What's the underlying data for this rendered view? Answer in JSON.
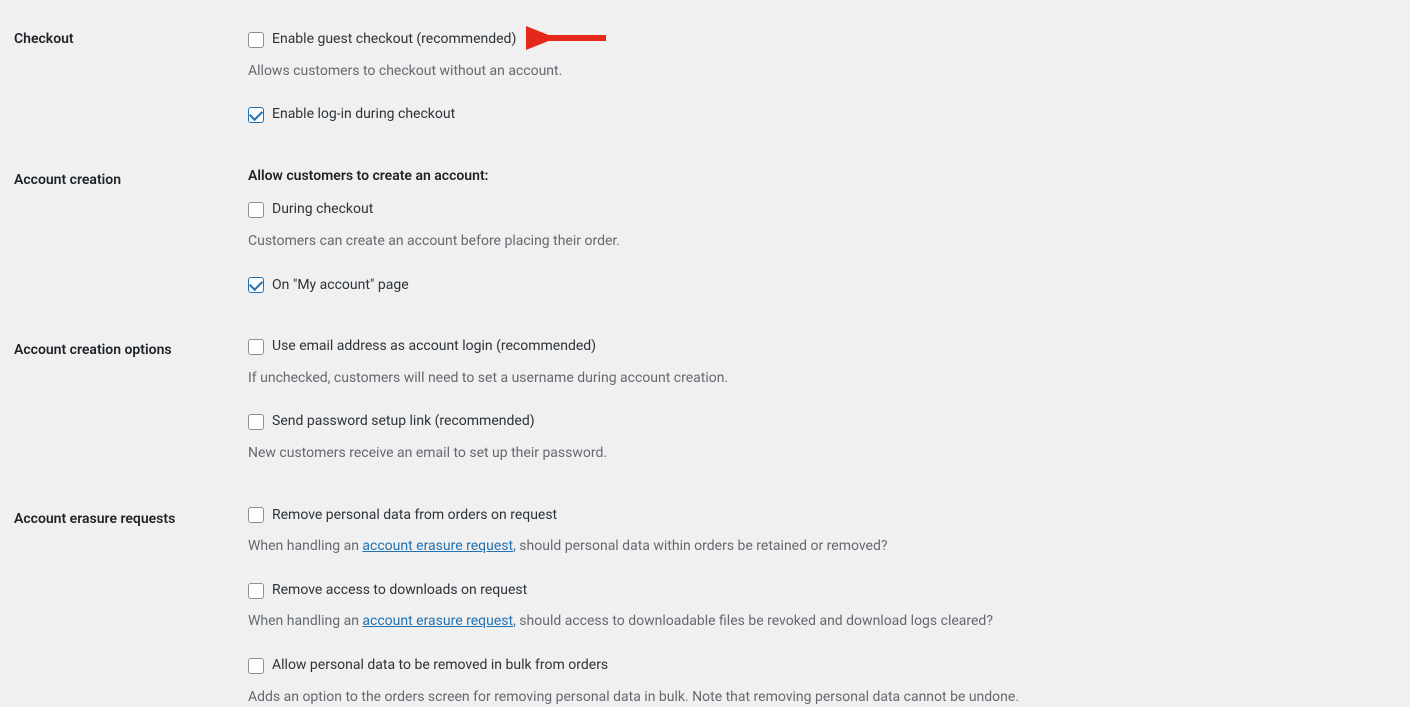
{
  "sections": {
    "checkout": {
      "title": "Checkout",
      "guest_checkout_label": "Enable guest checkout (recommended)",
      "guest_checkout_desc": "Allows customers to checkout without an account.",
      "login_during_checkout_label": "Enable log-in during checkout"
    },
    "account_creation": {
      "title": "Account creation",
      "subheading": "Allow customers to create an account:",
      "during_checkout_label": "During checkout",
      "during_checkout_desc": "Customers can create an account before placing their order.",
      "my_account_label": "On \"My account\" page"
    },
    "account_creation_options": {
      "title": "Account creation options",
      "email_login_label": "Use email address as account login (recommended)",
      "email_login_desc": "If unchecked, customers will need to set a username during account creation.",
      "password_link_label": "Send password setup link (recommended)",
      "password_link_desc": "New customers receive an email to set up their password."
    },
    "account_erasure": {
      "title": "Account erasure requests",
      "remove_personal_label": "Remove personal data from orders on request",
      "remove_personal_desc_prefix": "When handling an ",
      "remove_personal_desc_link": "account erasure request",
      "remove_personal_desc_suffix": ", should personal data within orders be retained or removed?",
      "remove_downloads_label": "Remove access to downloads on request",
      "remove_downloads_desc_prefix": "When handling an ",
      "remove_downloads_desc_link": "account erasure request",
      "remove_downloads_desc_suffix": ", should access to downloadable files be revoked and download logs cleared?",
      "bulk_label": "Allow personal data to be removed in bulk from orders",
      "bulk_desc": "Adds an option to the orders screen for removing personal data in bulk. Note that removing personal data cannot be undone."
    }
  }
}
